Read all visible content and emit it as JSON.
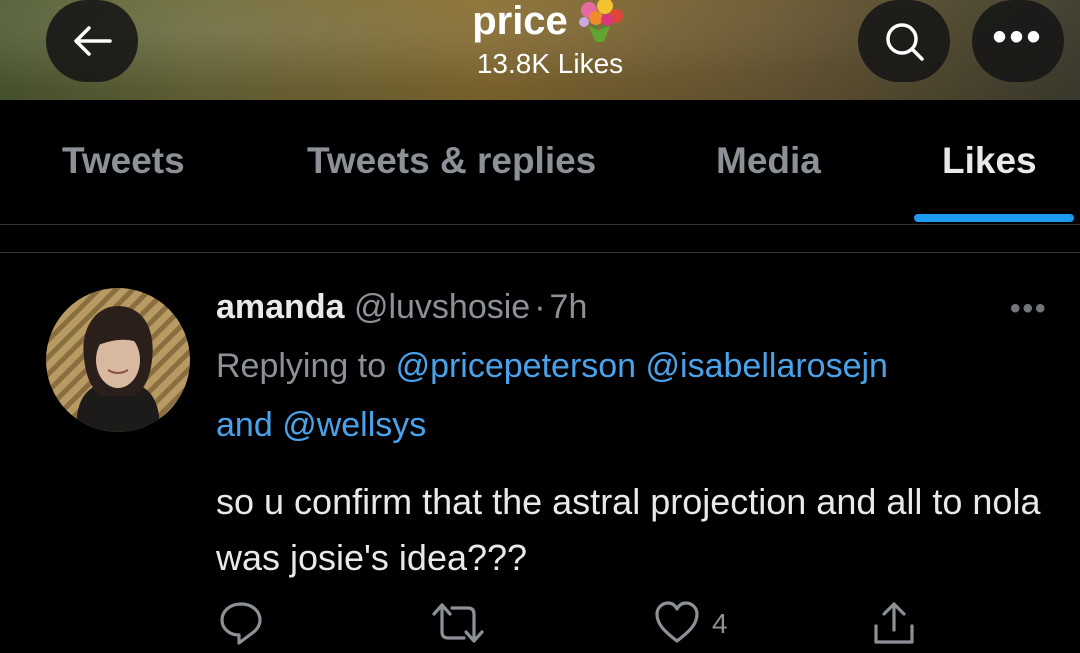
{
  "header": {
    "name": "price",
    "likes_count": "13.8K Likes",
    "icons": [
      "back-arrow-icon",
      "flower-bouquet-icon",
      "search-icon",
      "more-icon"
    ],
    "more_label": "•••"
  },
  "tabs": [
    {
      "label": "Tweets",
      "active": false
    },
    {
      "label": "Tweets & replies",
      "active": false
    },
    {
      "label": "Media",
      "active": false
    },
    {
      "label": "Likes",
      "active": true
    }
  ],
  "tweet": {
    "author_name": "amanda",
    "author_handle": "@luvshosie",
    "separator": "·",
    "time": "7h",
    "more_label": "•••",
    "replying_prefix": "Replying to",
    "mentions": [
      "@pricepeterson",
      "@isabellarosejn",
      "@wellsys"
    ],
    "and_label": "and",
    "text": "so u confirm that the astral projection and all to nola was josie's idea???",
    "actions": {
      "reply_icon": "reply-icon",
      "retweet_icon": "retweet-icon",
      "like_icon": "heart-icon",
      "like_count": "4",
      "share_icon": "share-icon"
    }
  },
  "colors": {
    "background": "#000000",
    "text": "#e7e9ea",
    "secondary_text": "#8b9196",
    "accent": "#1d9bf0",
    "mention": "#4aa3ea"
  }
}
